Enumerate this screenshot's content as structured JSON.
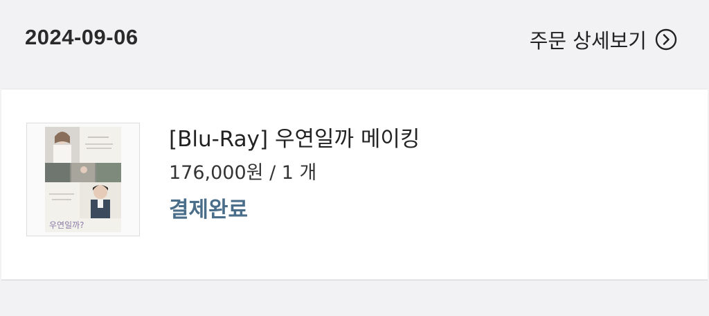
{
  "order": {
    "date": "2024-09-06",
    "detail_link_label": "주문 상세보기",
    "detail_icon": "chevron-right-circle-icon"
  },
  "item": {
    "title": "[Blu-Ray] 우연일까 메이킹",
    "price_line": "176,000원 / 1 개",
    "status": "결제완료",
    "status_color": "#4a6d8a",
    "poster_title": "우연일까?"
  }
}
